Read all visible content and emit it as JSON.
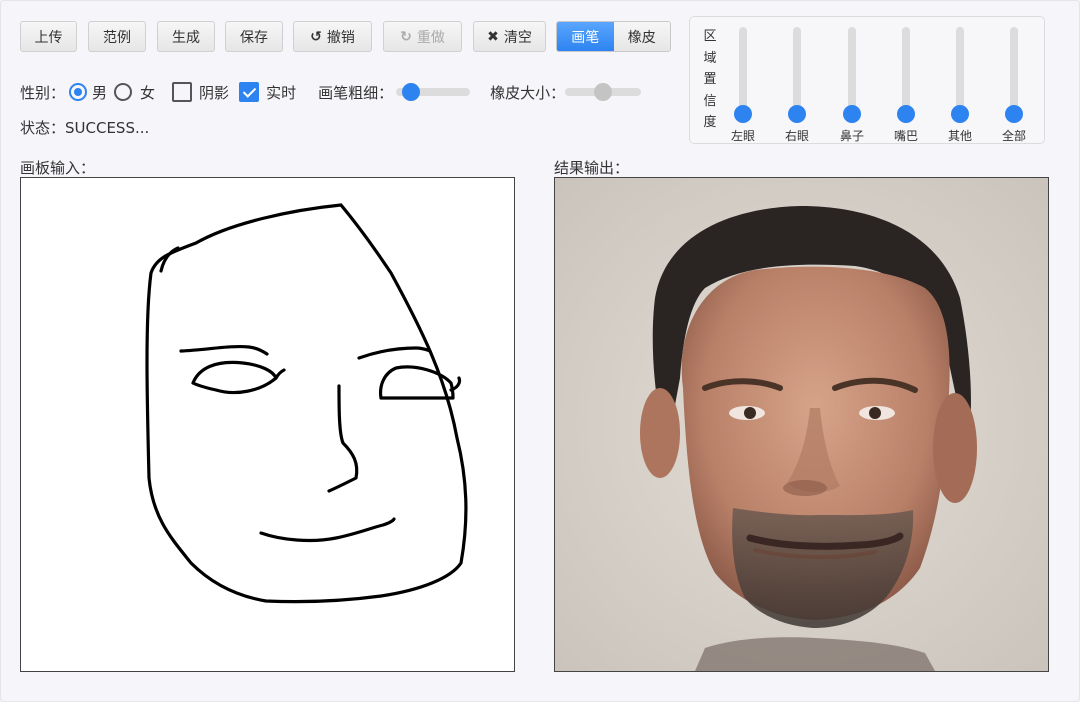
{
  "toolbar": {
    "upload": "上传",
    "example": "范例",
    "generate": "生成",
    "save": "保存",
    "undo": "撤销",
    "redo": "重做",
    "clear": "清空",
    "mode_brush": "画笔",
    "mode_eraser": "橡皮",
    "undo_icon": "undo-icon",
    "redo_icon": "redo-icon",
    "clear_icon": "close-icon"
  },
  "options": {
    "gender_label": "性别：",
    "male": "男",
    "female": "女",
    "gender_selected": "男",
    "shadow_label": "阴影",
    "shadow_checked": false,
    "realtime_label": "实时",
    "realtime_checked": true,
    "brush_size_label": "画笔粗细：",
    "brush_size_level": 0.1,
    "eraser_size_label": "橡皮大小：",
    "eraser_size_level": 0.5
  },
  "status": {
    "text": "状态：SUCCESS..."
  },
  "confidence": {
    "title": "区域置信度",
    "title_chars": [
      "区",
      "域",
      "置",
      "信",
      "度"
    ],
    "sliders": [
      {
        "label": "左眼",
        "level": 0
      },
      {
        "label": "右眼",
        "level": 0
      },
      {
        "label": "鼻子",
        "level": 0
      },
      {
        "label": "嘴巴",
        "level": 0
      },
      {
        "label": "其他",
        "level": 0
      },
      {
        "label": "全部",
        "level": 0
      }
    ]
  },
  "canvas_input": {
    "label": "画板输入："
  },
  "canvas_output": {
    "label": "结果输出："
  },
  "colors": {
    "accent": "#2d83f0",
    "track": "#dcdcdc",
    "disabled_knob": "#c4c4c4"
  }
}
